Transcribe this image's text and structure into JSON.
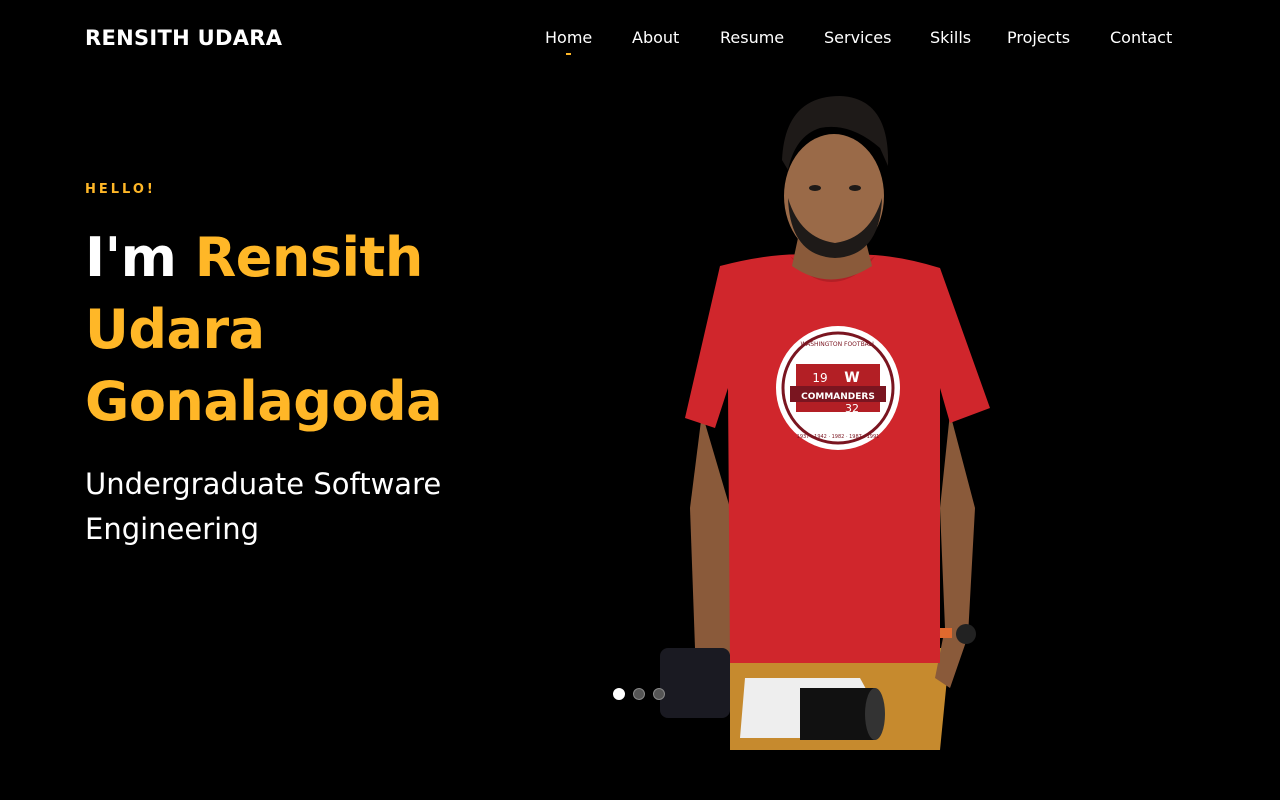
{
  "brand": {
    "name": "RENSITH UDARA"
  },
  "colors": {
    "accent": "#FFB727",
    "background": "#000000",
    "shirt": "#D0262C",
    "pants": "#C68A2E"
  },
  "nav": {
    "items": [
      {
        "label": "Home",
        "active": true
      },
      {
        "label": "About"
      },
      {
        "label": "Resume"
      },
      {
        "label": "Services"
      },
      {
        "label": "Skills"
      },
      {
        "label": "Projects"
      },
      {
        "label": "Contact"
      }
    ]
  },
  "hero": {
    "greeting": "HELLO!",
    "intro": "I'm ",
    "name_line1": "Rensith",
    "name_line2": "Udara",
    "name_line3": "Gonalagoda",
    "subtitle_line1": "Undergraduate Software",
    "subtitle_line2": "Engineering",
    "photo_icon": "portrait-photo-icon",
    "shirt_badge": {
      "top": "WASHINGTON FOOTBALL",
      "left_num": "19",
      "letter": "W",
      "banner": "COMMANDERS",
      "right_num": "32",
      "years": "1937 · 1942 · 1982 · 1987 · 1991"
    }
  },
  "carousel": {
    "slides": 3,
    "active_index": 0
  }
}
